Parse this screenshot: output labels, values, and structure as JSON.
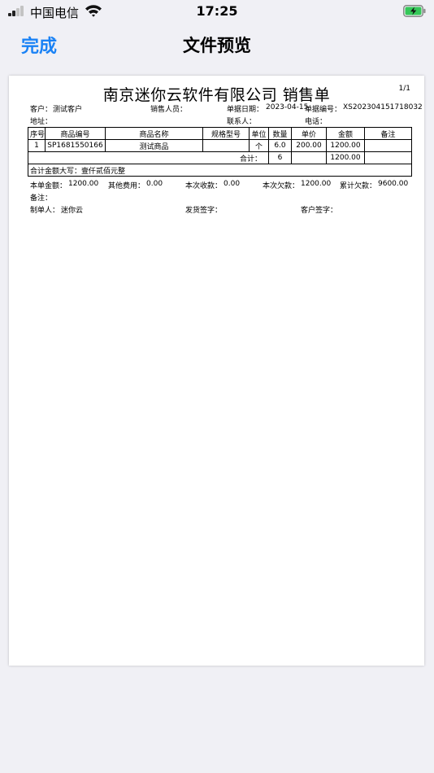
{
  "status_bar": {
    "carrier": "中国电信",
    "time": "17:25",
    "signal_bars": 2,
    "battery_state": "charging"
  },
  "nav": {
    "done_label": "完成",
    "title": "文件预览"
  },
  "document": {
    "title": "南京迷你云软件有限公司  销售单",
    "page": "1/1",
    "customer_label": "客户：",
    "customer_value": "测试客户",
    "salesperson_label": "销售人员：",
    "salesperson_value": "",
    "date_label": "单据日期：",
    "date_value": "2023-04-15",
    "number_label": "单据编号：",
    "number_value": "XS202304151718032",
    "address_label": "地址：",
    "address_value": "",
    "contact_label": "联系人：",
    "contact_value": "",
    "phone_label": "电话：",
    "phone_value": "",
    "table": {
      "headers": [
        "序号",
        "商品编号",
        "商品名称",
        "规格型号",
        "单位",
        "数量",
        "单价",
        "金额",
        "备注"
      ],
      "rows": [
        [
          "1",
          "SP1681550166",
          "测试商品",
          "",
          "个",
          "6.0",
          "200.00",
          "1200.00",
          ""
        ]
      ],
      "total_label": "合计：",
      "total_qty": "6",
      "total_amount": "1200.00",
      "uppercase_label": "合计金额大写：",
      "uppercase_value": "壹仟贰佰元整"
    },
    "summary": {
      "amount_label": "本单金额：",
      "amount_value": "1200.00",
      "other_label": "其他费用：",
      "other_value": "0.00",
      "received_label": "本次收款：",
      "received_value": "0.00",
      "owed_label": "本次欠款：",
      "owed_value": "1200.00",
      "cumulative_label": "累计欠款：",
      "cumulative_value": "9600.00"
    },
    "remark_label": "备注：",
    "remark_value": "",
    "maker_label": "制单人：",
    "maker_value": "迷你云",
    "shipper_label": "发货签字：",
    "shipper_value": "",
    "receiver_label": "客户签字：",
    "receiver_value": ""
  }
}
